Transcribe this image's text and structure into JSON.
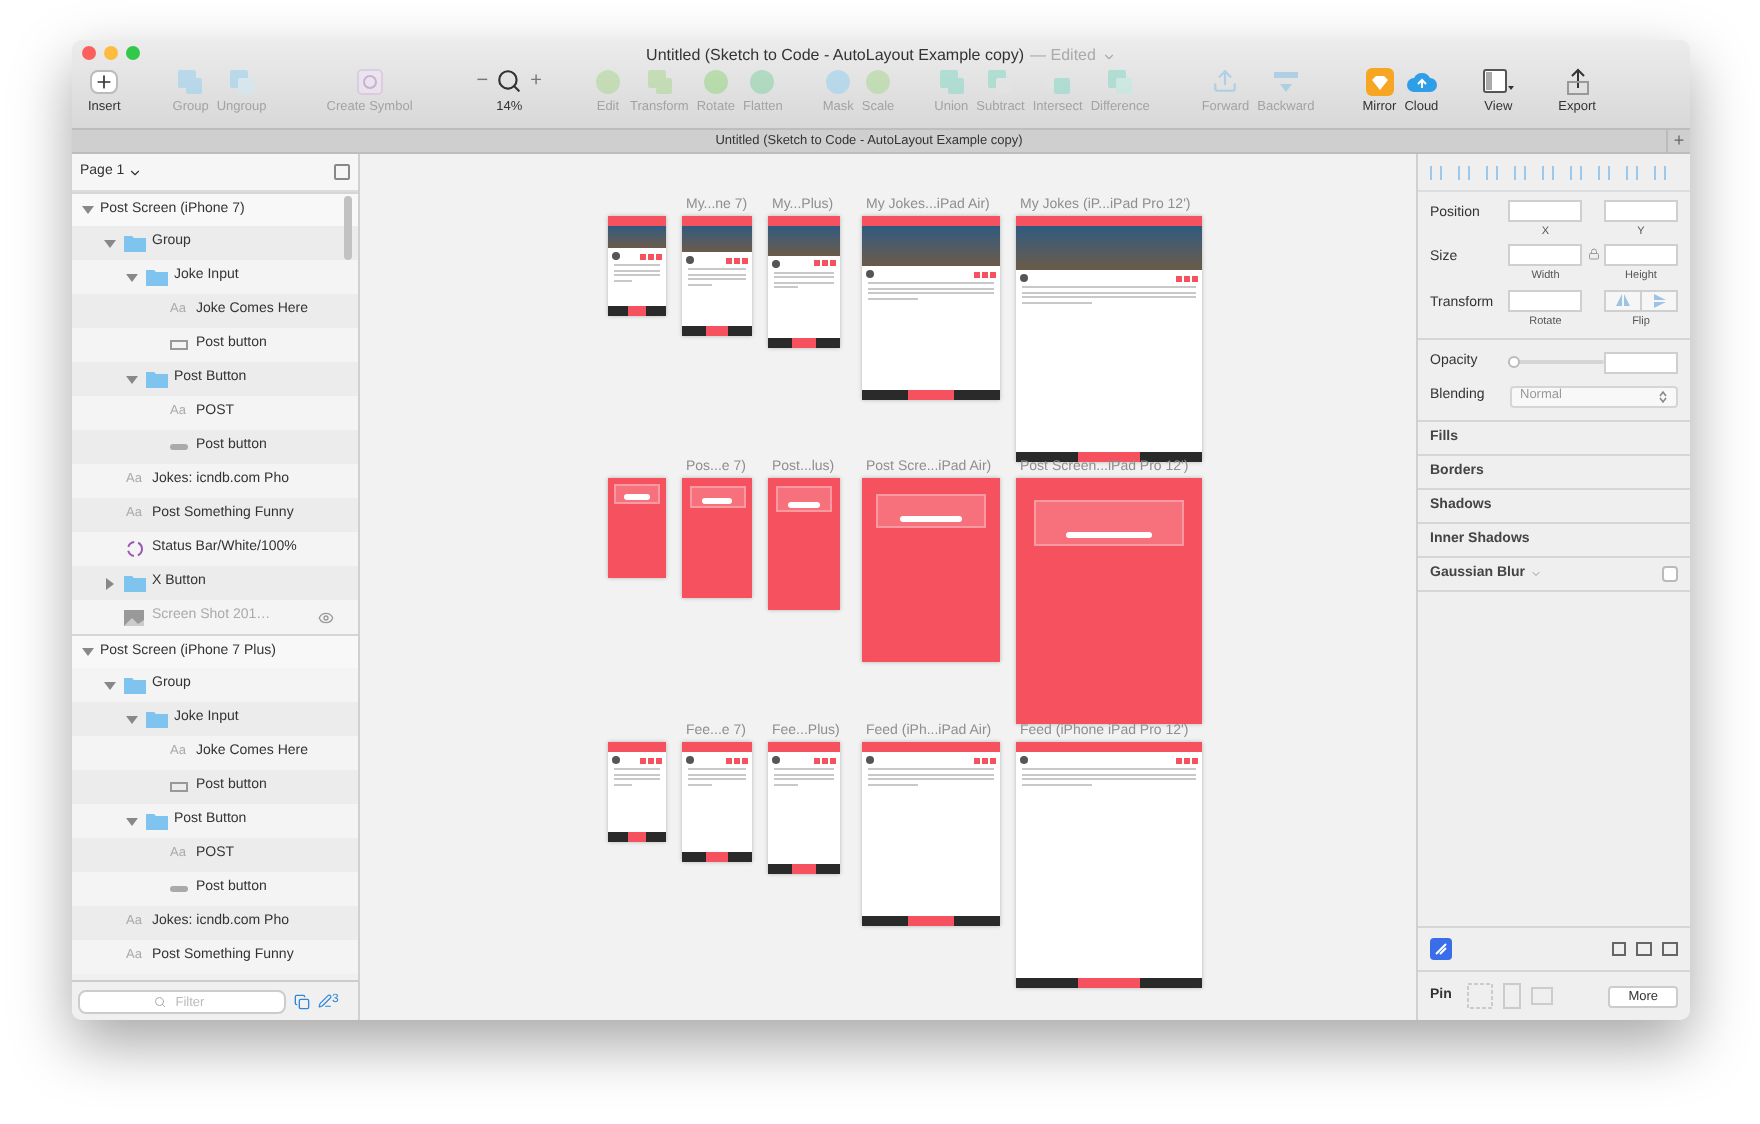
{
  "window": {
    "title": "Untitled (Sketch to Code - AutoLayout Example copy)",
    "edited": "— Edited"
  },
  "toolbar": [
    {
      "label": "Insert",
      "disabled": false
    },
    {
      "label": "Group",
      "disabled": true
    },
    {
      "label": "Ungroup",
      "disabled": true
    },
    {
      "label": "Create Symbol",
      "disabled": true
    },
    {
      "label": "14%",
      "disabled": false,
      "minus": "−",
      "plus": "+"
    },
    {
      "label": "Edit",
      "disabled": true
    },
    {
      "label": "Transform",
      "disabled": true
    },
    {
      "label": "Rotate",
      "disabled": true
    },
    {
      "label": "Flatten",
      "disabled": true
    },
    {
      "label": "Mask",
      "disabled": true
    },
    {
      "label": "Scale",
      "disabled": true
    },
    {
      "label": "Union",
      "disabled": true
    },
    {
      "label": "Subtract",
      "disabled": true
    },
    {
      "label": "Intersect",
      "disabled": true
    },
    {
      "label": "Difference",
      "disabled": true
    },
    {
      "label": "Forward",
      "disabled": true
    },
    {
      "label": "Backward",
      "disabled": true
    },
    {
      "label": "Mirror",
      "disabled": false
    },
    {
      "label": "Cloud",
      "disabled": false
    },
    {
      "label": "View",
      "disabled": false
    },
    {
      "label": "Export",
      "disabled": false
    }
  ],
  "tab": {
    "title": "Untitled (Sketch to Code - AutoLayout Example copy)",
    "add": "+"
  },
  "sidebar": {
    "page": "Page 1",
    "filter_placeholder": "Filter",
    "count": "3",
    "layers": [
      {
        "name": "Post Screen (iPhone 7)",
        "kind": "artboard",
        "expanded": true,
        "hidden": false,
        "children": [
          {
            "name": "Group",
            "kind": "group",
            "expanded": true,
            "hidden": false,
            "children": [
              {
                "name": "Joke Input",
                "kind": "group",
                "expanded": true,
                "hidden": false,
                "children": [
                  {
                    "name": "Joke Comes Here",
                    "kind": "text",
                    "icon": "Aa",
                    "hidden": false
                  },
                  {
                    "name": "Post button",
                    "kind": "rect",
                    "hidden": false
                  }
                ]
              },
              {
                "name": "Post Button",
                "kind": "group",
                "expanded": true,
                "hidden": false,
                "children": [
                  {
                    "name": "POST",
                    "kind": "text",
                    "icon": "Aa",
                    "hidden": false
                  },
                  {
                    "name": "Post button",
                    "kind": "shape",
                    "hidden": false
                  }
                ]
              }
            ]
          },
          {
            "name": "Jokes: icndb.com Pho",
            "kind": "text",
            "icon": "Aa",
            "hidden": false
          },
          {
            "name": "Post Something Funny",
            "kind": "text",
            "icon": "Aa",
            "hidden": false
          },
          {
            "name": "Status Bar/White/100%",
            "kind": "symbol",
            "hidden": false
          },
          {
            "name": "X Button",
            "kind": "group",
            "expanded": false,
            "hidden": false
          },
          {
            "name": "Screen Shot 201…",
            "kind": "image",
            "hidden": true
          }
        ]
      },
      {
        "name": "Post Screen (iPhone 7 Plus)",
        "kind": "artboard",
        "expanded": true,
        "hidden": false,
        "children": [
          {
            "name": "Group",
            "kind": "group",
            "expanded": true,
            "hidden": false,
            "children": [
              {
                "name": "Joke Input",
                "kind": "group",
                "expanded": true,
                "hidden": false,
                "children": [
                  {
                    "name": "Joke Comes Here",
                    "kind": "text",
                    "icon": "Aa",
                    "hidden": false
                  },
                  {
                    "name": "Post button",
                    "kind": "rect",
                    "hidden": false
                  }
                ]
              },
              {
                "name": "Post Button",
                "kind": "group",
                "expanded": true,
                "hidden": false,
                "children": [
                  {
                    "name": "POST",
                    "kind": "text",
                    "icon": "Aa",
                    "hidden": false
                  },
                  {
                    "name": "Post button",
                    "kind": "shape",
                    "hidden": false
                  }
                ]
              }
            ]
          },
          {
            "name": "Jokes: icndb.com Pho",
            "kind": "text",
            "icon": "Aa",
            "hidden": false
          },
          {
            "name": "Post Something Funny",
            "kind": "text",
            "icon": "Aa",
            "hidden": false
          }
        ]
      }
    ]
  },
  "canvas": {
    "rows": [
      {
        "kind": "jokes",
        "artboards": [
          {
            "kind": "se"
          },
          {
            "kind": "iphone",
            "label": "My...ne 7)"
          },
          {
            "kind": "plus",
            "label": "My...Plus)"
          },
          {
            "kind": "air",
            "label": "My Jokes...iPad Air)"
          },
          {
            "kind": "pro",
            "label": "My Jokes (iP...iPad Pro 12')"
          }
        ]
      },
      {
        "kind": "post",
        "artboards": [
          {
            "kind": "se"
          },
          {
            "kind": "iphone",
            "label": "Pos...e 7)"
          },
          {
            "kind": "plus",
            "label": "Post...lus)"
          },
          {
            "kind": "air",
            "label": "Post Scre...iPad Air)"
          },
          {
            "kind": "pro",
            "label": "Post Screen...iPad Pro 12')"
          }
        ]
      },
      {
        "kind": "feed",
        "artboards": [
          {
            "kind": "se"
          },
          {
            "kind": "iphone",
            "label": "Fee...e 7)"
          },
          {
            "kind": "plus",
            "label": "Fee...Plus)"
          },
          {
            "kind": "air",
            "label": "Feed (iPh...iPad Air)"
          },
          {
            "kind": "pro",
            "label": "Feed (iPhone iPad Pro 12')"
          }
        ]
      }
    ]
  },
  "inspector": {
    "position": {
      "label": "Position",
      "x": "X",
      "y": "Y"
    },
    "size": {
      "label": "Size",
      "width": "Width",
      "height": "Height"
    },
    "transform": {
      "label": "Transform",
      "rotate": "Rotate",
      "flip": "Flip"
    },
    "opacity": {
      "label": "Opacity",
      "level": 0
    },
    "blending": {
      "label": "Blending",
      "value": "Normal"
    },
    "sections": [
      "Fills",
      "Borders",
      "Shadows",
      "Inner Shadows"
    ],
    "blur": {
      "label": "Gaussian Blur",
      "checked": false
    },
    "pin": {
      "label": "Pin",
      "button": "More"
    }
  }
}
